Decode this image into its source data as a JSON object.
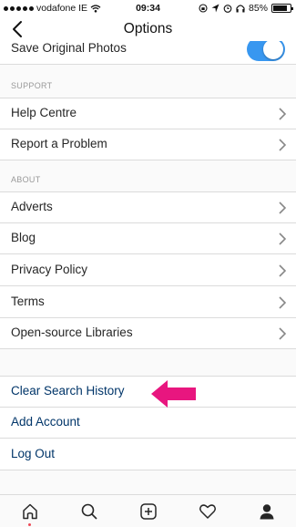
{
  "status_bar": {
    "carrier": "vodafone IE",
    "time": "09:34",
    "battery": "85%",
    "battery_level": 0.85
  },
  "nav": {
    "title": "Options"
  },
  "photos": {
    "label": "Save Original Photos",
    "enabled": true
  },
  "support": {
    "header": "SUPPORT",
    "items": [
      "Help Centre",
      "Report a Problem"
    ]
  },
  "about": {
    "header": "ABOUT",
    "items": [
      "Adverts",
      "Blog",
      "Privacy Policy",
      "Terms",
      "Open-source Libraries"
    ]
  },
  "actions": {
    "items": [
      "Clear Search History",
      "Add Account",
      "Log Out"
    ]
  },
  "colors": {
    "toggle": "#3897f0",
    "link": "#003569",
    "arrow": "#e8167f"
  },
  "tabs": [
    "home-icon",
    "search-icon",
    "add-icon",
    "heart-icon",
    "profile-icon"
  ]
}
